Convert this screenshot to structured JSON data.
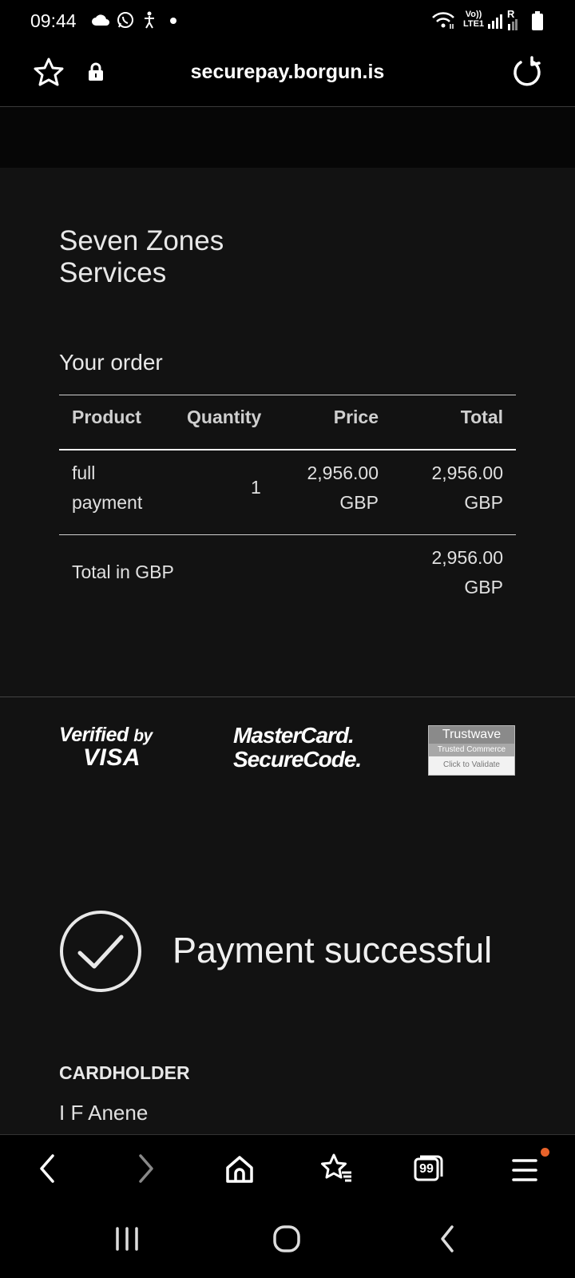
{
  "status_bar": {
    "time": "09:44",
    "network_label": "Vo)) LTE1",
    "roaming": "R",
    "icons": [
      "cloud-icon",
      "whatsapp-icon",
      "accessibility-icon",
      "dot-icon",
      "wifi-icon",
      "signal-icon",
      "battery-icon"
    ]
  },
  "address_bar": {
    "url": "securepay.borgun.is"
  },
  "merchant": {
    "name": "Seven Zones Services"
  },
  "order": {
    "title": "Your order",
    "columns": [
      "Product",
      "Quantity",
      "Price",
      "Total"
    ],
    "rows": [
      {
        "product_line1": "full",
        "product_line2": "payment",
        "quantity": "1",
        "price_line1": "2,956.00",
        "price_line2": "GBP",
        "total_line1": "2,956.00",
        "total_line2": "GBP"
      }
    ],
    "total_label": "Total in GBP",
    "total_line1": "2,956.00",
    "total_line2": "GBP"
  },
  "security_logos": {
    "visa_line1": "Verified",
    "visa_by": "by",
    "visa_line2": "VISA",
    "mastercard_line1": "MasterCard.",
    "mastercard_line2": "SecureCode.",
    "trustwave_title": "Trustwave",
    "trustwave_sub": "Trusted Commerce",
    "trustwave_link": "Click to Validate"
  },
  "result": {
    "message": "Payment successful"
  },
  "cardholder": {
    "label": "CARDHOLDER",
    "name": "I F Anene"
  },
  "toolbar": {
    "tab_count": "99",
    "has_notification": true,
    "notification_color": "#e8622a"
  },
  "colors": {
    "page_bg": "#121212",
    "bar_bg": "#000000",
    "text": "#ffffff"
  }
}
